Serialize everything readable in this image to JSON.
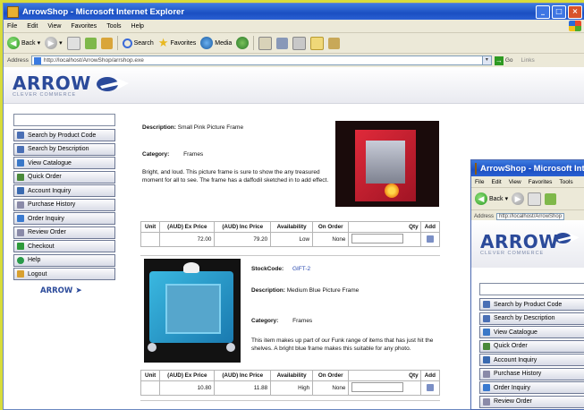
{
  "main_window": {
    "title": "ArrowShop - Microsoft Internet Explorer",
    "menu": [
      "File",
      "Edit",
      "View",
      "Favorites",
      "Tools",
      "Help"
    ],
    "toolbar": {
      "back": "Back",
      "search": "Search",
      "favorites": "Favorites",
      "media": "Media"
    },
    "address": {
      "label": "Address",
      "url": "http://localhost/ArrowShop/arrshop.exe",
      "go": "Go",
      "links": "Links"
    }
  },
  "site": {
    "logo": "ARROW",
    "tagline": "CLEVER COMMERCE",
    "sidebar_logo": "ARROW"
  },
  "nav": [
    {
      "label": "Search by Product Code",
      "icon": "search-icon",
      "color": "#4a6fb5"
    },
    {
      "label": "Search by Description",
      "icon": "search-icon",
      "color": "#4a6fb5"
    },
    {
      "label": "View Catalogue",
      "icon": "catalogue-icon",
      "color": "#3a78c8"
    },
    {
      "label": "Quick Order",
      "icon": "order-icon",
      "color": "#4a8a3a"
    },
    {
      "label": "Account Inquiry",
      "icon": "account-icon",
      "color": "#3a6ab0"
    },
    {
      "label": "Purchase History",
      "icon": "history-icon",
      "color": "#8a8aa8"
    },
    {
      "label": "Order Inquiry",
      "icon": "inquiry-icon",
      "color": "#3a7ad0"
    },
    {
      "label": "Review Order",
      "icon": "review-icon",
      "color": "#8a8aa8"
    },
    {
      "label": "Checkout",
      "icon": "checkout-icon",
      "color": "#2e9a3a"
    },
    {
      "label": "Help",
      "icon": "help-icon",
      "color": "#2a9a4a"
    },
    {
      "label": "Logout",
      "icon": "logout-icon",
      "color": "#d8a030"
    }
  ],
  "products": [
    {
      "description_label": "Description:",
      "description": "Small Pink Picture Frame",
      "category_label": "Category:",
      "category": "Frames",
      "blurb": "Bright, and loud. This picture frame is sure to show the any treasured moment for all to see. The frame has a daffodil sketched in to add effect.",
      "ex_price": "72.00",
      "inc_price": "79.20",
      "availability": "Low",
      "on_order": "None"
    },
    {
      "stock_label": "StockCode:",
      "stock_code": "GIFT-2",
      "description_label": "Description:",
      "description": "Medium Blue Picture Frame",
      "category_label": "Category:",
      "category": "Frames",
      "blurb": "This item makes up part of our Funk range of items that has just hit the shelves. A bright blue frame makes this suitable for any photo.",
      "ex_price": "10.80",
      "inc_price": "11.88",
      "availability": "High",
      "on_order": "None"
    }
  ],
  "table_headers": [
    "Unit",
    "(AUD) Ex Price",
    "(AUD) Inc Price",
    "Availability",
    "On Order",
    "Qty",
    "Add"
  ],
  "second_window": {
    "title": "ArrowShop - Microsoft Internet Explorer",
    "menu": [
      "File",
      "Edit",
      "View",
      "Favorites",
      "Tools"
    ],
    "back": "Back",
    "address_label": "Address",
    "url": "http://localhost/ArrowShop",
    "nav": [
      "Search by Product Code",
      "Search by Description",
      "View Catalogue",
      "Quick Order",
      "Account Inquiry",
      "Purchase History",
      "Order Inquiry",
      "Review Order"
    ]
  },
  "colors": {
    "background": "#d8dc3a",
    "title_bar": "#1b4fc2",
    "brand": "#2b4a9a",
    "link": "#2a4ab0"
  }
}
